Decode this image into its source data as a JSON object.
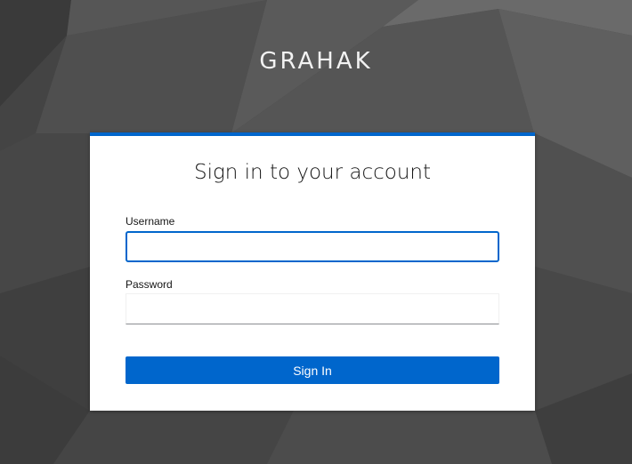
{
  "brand": {
    "name": "GRAHAK"
  },
  "login_form": {
    "title": "Sign in to your account",
    "username": {
      "label": "Username",
      "value": "",
      "placeholder": ""
    },
    "password": {
      "label": "Password",
      "value": "",
      "placeholder": ""
    },
    "submit_label": "Sign In"
  },
  "colors": {
    "accent": "#0066cc",
    "background": "#4a4a4a",
    "card": "#ffffff"
  }
}
